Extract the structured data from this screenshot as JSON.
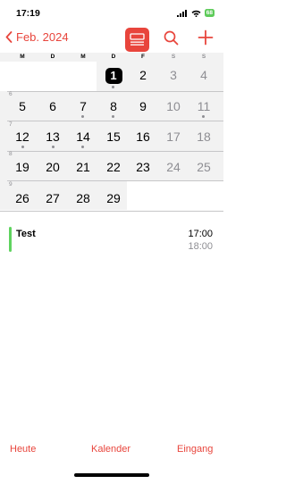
{
  "status": {
    "time": "17:19",
    "battery": "68"
  },
  "nav": {
    "back_label": "Feb. 2024"
  },
  "weekdays": [
    "M",
    "D",
    "M",
    "D",
    "F",
    "S",
    "S"
  ],
  "weeks": [
    {
      "week_number": "",
      "days": [
        "",
        "",
        "",
        "1",
        "2",
        "3",
        "4"
      ]
    },
    {
      "week_number": "6",
      "days": [
        "5",
        "6",
        "7",
        "8",
        "9",
        "10",
        "11"
      ]
    },
    {
      "week_number": "7",
      "days": [
        "12",
        "13",
        "14",
        "15",
        "16",
        "17",
        "18"
      ]
    },
    {
      "week_number": "8",
      "days": [
        "19",
        "20",
        "21",
        "22",
        "23",
        "24",
        "25"
      ]
    },
    {
      "week_number": "9",
      "days": [
        "26",
        "27",
        "28",
        "29",
        "",
        "",
        ""
      ]
    }
  ],
  "events_list": [
    {
      "title": "Test",
      "start": "17:00",
      "end": "18:00",
      "color": "#5fd35f"
    }
  ],
  "tabs": {
    "today": "Heute",
    "calendars": "Kalender",
    "inbox": "Eingang"
  },
  "colors": {
    "accent": "#e8453c",
    "muted": "#8e8e93"
  }
}
